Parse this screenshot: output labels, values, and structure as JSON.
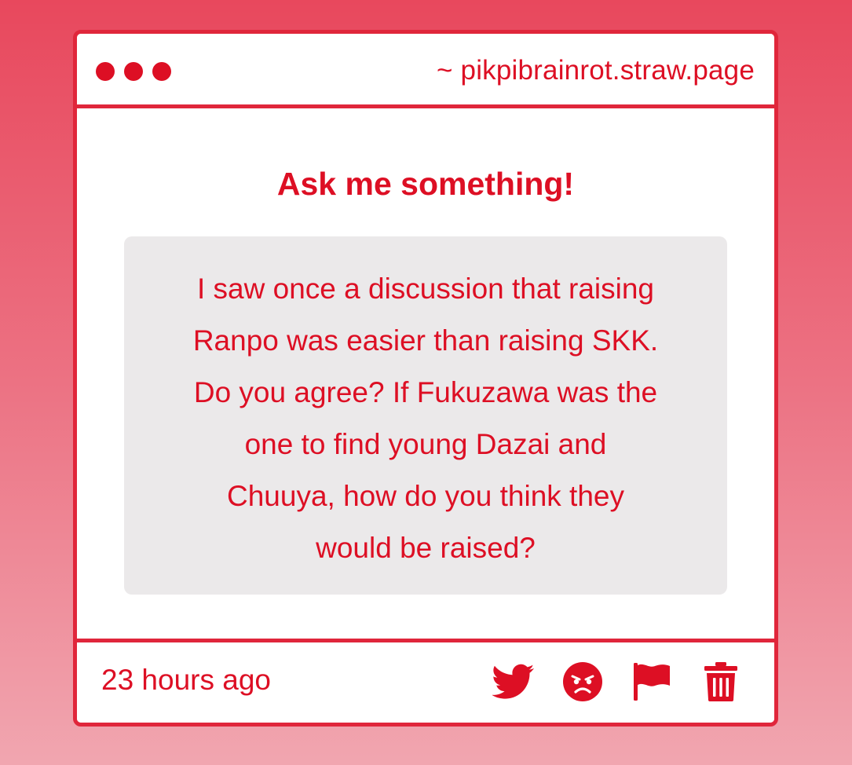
{
  "window": {
    "dots": [
      "dot",
      "dot",
      "dot"
    ],
    "url": "~ pikpibrainrot.straw.page"
  },
  "main": {
    "heading": "Ask me something!",
    "question_lines": [
      "I saw once a discussion that raising",
      "Ranpo was easier than raising SKK.",
      "Do you agree? If Fukuzawa was the",
      "one to find young Dazai and",
      "Chuuya, how do you think they",
      "would be raised?"
    ]
  },
  "footer": {
    "timestamp": "23 hours ago",
    "actions": [
      {
        "icon": "twitter-icon"
      },
      {
        "icon": "angry-face-icon"
      },
      {
        "icon": "flag-icon"
      },
      {
        "icon": "trash-icon"
      }
    ]
  },
  "colors": {
    "accent": "#dd0f24",
    "border": "#e0263b",
    "question_bg": "#ebe9ea"
  }
}
